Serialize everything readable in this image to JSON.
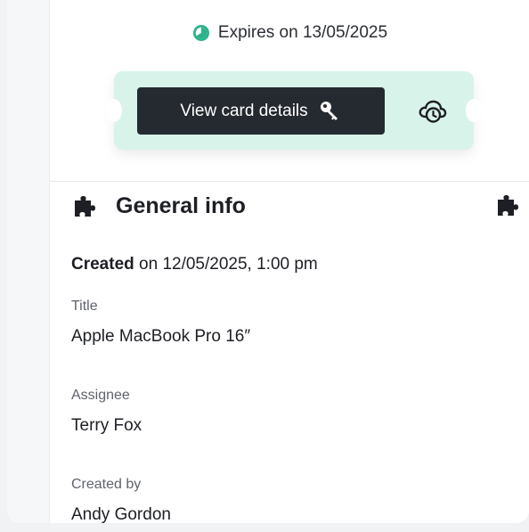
{
  "expiry": {
    "text": "Expires on 13/05/2025",
    "icon": "clock-progress-icon",
    "color": "#2bb38a"
  },
  "card": {
    "button_label": "View card details",
    "button_icon": "key-icon",
    "secondary_icon": "cloud-clock-icon",
    "background": "#d8f3ea"
  },
  "section": {
    "title": "General info",
    "icon": "puzzle-icon"
  },
  "created": {
    "bold": "Created",
    "rest": " on 12/05/2025, 1:00 pm"
  },
  "fields": [
    {
      "label": "Title",
      "value": "Apple MacBook Pro 16″"
    },
    {
      "label": "Assignee",
      "value": "Terry Fox"
    },
    {
      "label": "Created by",
      "value": "Andy Gordon"
    }
  ]
}
